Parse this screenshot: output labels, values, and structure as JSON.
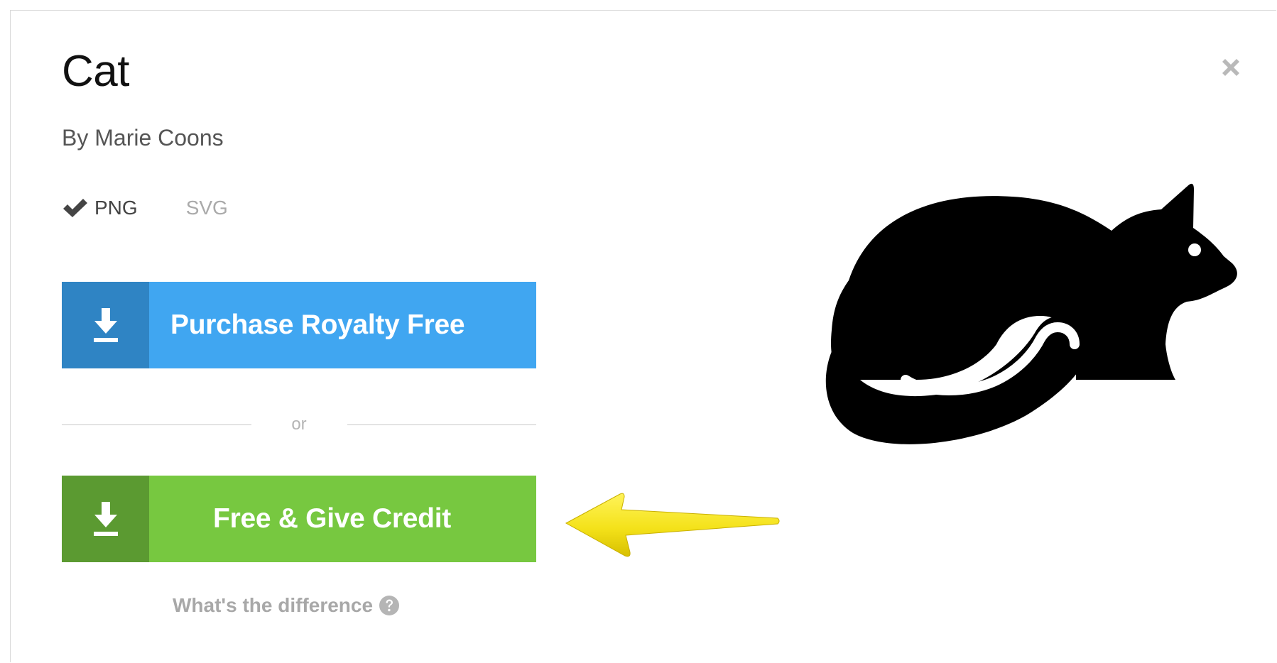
{
  "icon": {
    "title": "Cat",
    "author": "By Marie Coons"
  },
  "formats": {
    "png_label": "PNG",
    "svg_label": "SVG",
    "selected": "PNG"
  },
  "actions": {
    "purchase_label": "Purchase Royalty Free",
    "divider_label": "or",
    "free_label": "Free & Give Credit",
    "difference_label": "What's the difference"
  },
  "icons": {
    "close": "close-icon",
    "check": "check-icon",
    "download": "download-icon",
    "help": "question-circle-icon",
    "arrow": "arrow-left-icon",
    "preview": "cat-icon"
  },
  "colors": {
    "purchase": "#40a6f1",
    "purchase_icon_bg": "#2f84c4",
    "free": "#77c840",
    "free_icon_bg": "#5b9a31",
    "arrow": "#f4e21a"
  }
}
